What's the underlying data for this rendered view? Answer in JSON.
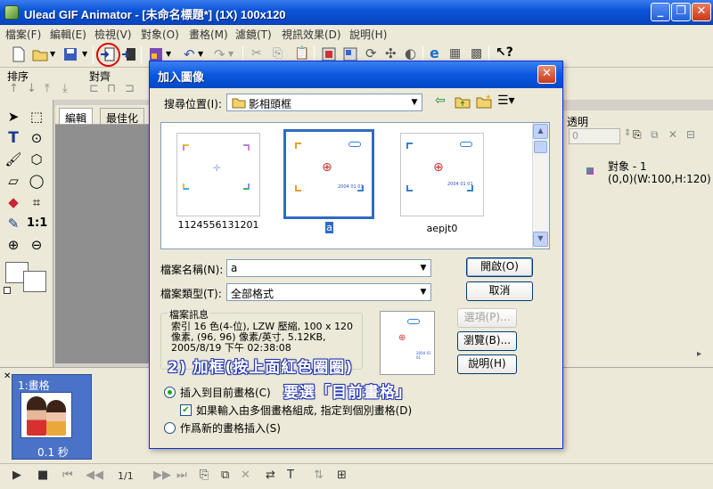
{
  "window": {
    "title": "Ulead GIF Animator - [未命名標題*] (1X) 100x120"
  },
  "menu": [
    "檔案(F)",
    "編輯(E)",
    "檢視(V)",
    "對象(O)",
    "畫格(M)",
    "濾鏡(T)",
    "視訊效果(D)",
    "說明(H)"
  ],
  "toolbar2": {
    "sort_label": "排序",
    "align_label": "對齊"
  },
  "tabs": [
    "編輯",
    "最佳化"
  ],
  "right_panel": {
    "transparency_label": "透明",
    "transparency_value": "0",
    "object_name": "對象 - 1",
    "object_info": "(0,0)(W:100,H:120)"
  },
  "frames": {
    "frame_label": "1:畫格",
    "frame_time": "0.1 秒",
    "page_indicator": "1/1"
  },
  "dialog": {
    "title": "加入圖像",
    "look_in_label": "搜尋位置(I):",
    "look_in_value": "影相頭框",
    "files": [
      {
        "name": "1124556131201",
        "selected": false
      },
      {
        "name": "a",
        "selected": true
      },
      {
        "name": "aepjt0",
        "selected": false
      }
    ],
    "filename_label": "檔案名稱(N):",
    "filename_value": "a",
    "filetype_label": "檔案類型(T):",
    "filetype_value": "全部格式",
    "open_button": "開啟(O)",
    "cancel_button": "取消",
    "options_button": "選項(P)...",
    "browse_button": "瀏覽(B)...",
    "help_button": "說明(H)",
    "file_info_title": "檔案訊息",
    "file_info_text": "索引 16 色(4-位), LZW 壓縮, 100 x 120\n像素, (96, 96) 像素/英寸, 5.12KB,\n2005/8/19  下午 02:38:08",
    "radio_insert_current": "插入到目前畫格(C)",
    "checkbox_assign_frames": "如果輸入由多個畫格組成, 指定到個別畫格(D)",
    "radio_insert_new": "作爲新的畫格插入(S)",
    "thumb_date": "2004 01 01"
  },
  "annotation": {
    "line1": "2)  加框(按上面紅色圈圈)",
    "line2": "要選「目前畫格」"
  },
  "colors": {
    "title_blue": "#0a58e0",
    "selection_blue": "#316ac5",
    "highlight_red": "#e00000"
  }
}
